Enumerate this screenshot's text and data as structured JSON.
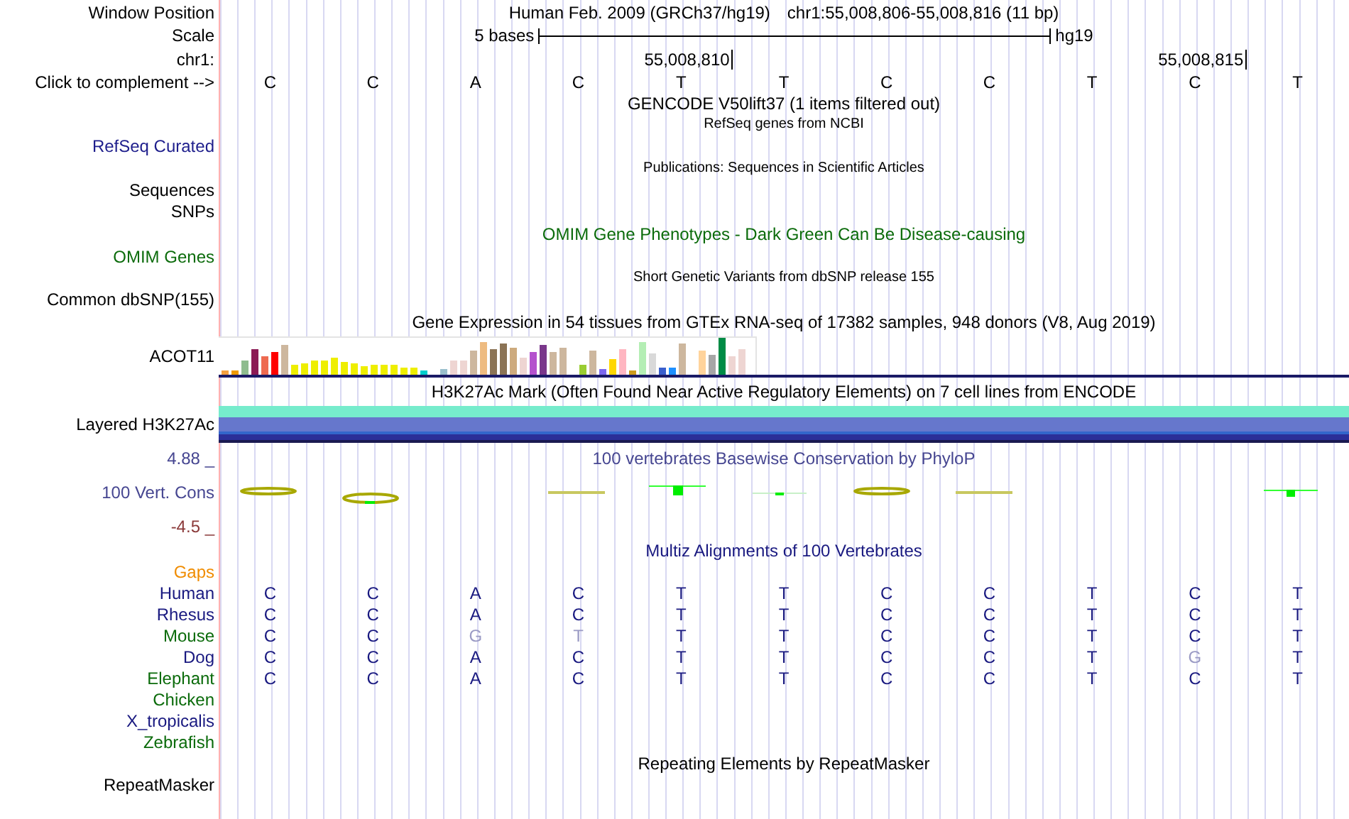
{
  "header": {
    "window_position_label": "Window Position",
    "assembly": "Human Feb. 2009 (GRCh37/hg19)",
    "position": "chr1:55,008,806-55,008,816 (11 bp)",
    "scale_label": "Scale",
    "scale_text": "5 bases",
    "scale_db": "hg19",
    "chrom_label": "chr1:",
    "complement_label": "Click to complement -->"
  },
  "sequence": [
    {
      "base": "C"
    },
    {
      "base": "C"
    },
    {
      "base": "A"
    },
    {
      "base": "C"
    },
    {
      "base": "T",
      "tick": "55,008,810"
    },
    {
      "base": "T"
    },
    {
      "base": "C"
    },
    {
      "base": "C"
    },
    {
      "base": "T"
    },
    {
      "base": "C",
      "tick": "55,008,815"
    },
    {
      "base": "T"
    }
  ],
  "gencode": {
    "title": "GENCODE V50lift37 (1 items filtered out)"
  },
  "refseq": {
    "title": "RefSeq genes from NCBI",
    "label": "RefSeq Curated"
  },
  "publications": {
    "title": "Publications: Sequences in Scientific Articles",
    "labels": [
      "Sequences",
      "SNPs"
    ]
  },
  "omim": {
    "title": "OMIM Gene Phenotypes - Dark Green Can Be Disease-causing",
    "label": "OMIM Genes"
  },
  "dbsnp": {
    "title": "Short Genetic Variants from dbSNP release 155",
    "label": "Common dbSNP(155)"
  },
  "gtex": {
    "title": "Gene Expression in 54 tissues from GTEx RNA-seq of 17382 samples, 948 donors (V8, Aug 2019)",
    "label": "ACOT11"
  },
  "h3k27ac": {
    "title": "H3K27Ac Mark (Often Found Near Active Regulatory Elements) on 7 cell lines from ENCODE",
    "label": "Layered H3K27Ac"
  },
  "conservation": {
    "title": "100 vertebrates Basewise Conservation by PhyloP",
    "label": "100 Vert. Cons",
    "max": "4.88 _",
    "min": "-4.5 _"
  },
  "multiz": {
    "title": "Multiz Alignments of 100 Vertebrates",
    "species": [
      {
        "name": "Gaps",
        "color": "#f08c00"
      },
      {
        "name": "Human",
        "color": "#191980",
        "bases": [
          {
            "base": "C",
            "differs": false
          },
          {
            "base": "C",
            "differs": false
          },
          {
            "base": "A",
            "differs": false
          },
          {
            "base": "C",
            "differs": false
          },
          {
            "base": "T",
            "differs": false
          },
          {
            "base": "T",
            "differs": false
          },
          {
            "base": "C",
            "differs": false
          },
          {
            "base": "C",
            "differs": false
          },
          {
            "base": "T",
            "differs": false
          },
          {
            "base": "C",
            "differs": false
          },
          {
            "base": "T",
            "differs": false
          }
        ]
      },
      {
        "name": "Rhesus",
        "color": "#191980",
        "bases": [
          {
            "base": "C",
            "differs": false
          },
          {
            "base": "C",
            "differs": false
          },
          {
            "base": "A",
            "differs": false
          },
          {
            "base": "C",
            "differs": false
          },
          {
            "base": "T",
            "differs": false
          },
          {
            "base": "T",
            "differs": false
          },
          {
            "base": "C",
            "differs": false
          },
          {
            "base": "C",
            "differs": false
          },
          {
            "base": "T",
            "differs": false
          },
          {
            "base": "C",
            "differs": false
          },
          {
            "base": "T",
            "differs": false
          }
        ]
      },
      {
        "name": "Mouse",
        "color": "#0b6b0b",
        "bases": [
          {
            "base": "C",
            "differs": false
          },
          {
            "base": "C",
            "differs": false
          },
          {
            "base": "G",
            "differs": true
          },
          {
            "base": "T",
            "differs": true
          },
          {
            "base": "T",
            "differs": false
          },
          {
            "base": "T",
            "differs": false
          },
          {
            "base": "C",
            "differs": false
          },
          {
            "base": "C",
            "differs": false
          },
          {
            "base": "T",
            "differs": false
          },
          {
            "base": "C",
            "differs": false
          },
          {
            "base": "T",
            "differs": false
          }
        ]
      },
      {
        "name": "Dog",
        "color": "#191980",
        "bases": [
          {
            "base": "C",
            "differs": false
          },
          {
            "base": "C",
            "differs": false
          },
          {
            "base": "A",
            "differs": false
          },
          {
            "base": "C",
            "differs": false
          },
          {
            "base": "T",
            "differs": false
          },
          {
            "base": "T",
            "differs": false
          },
          {
            "base": "C",
            "differs": false
          },
          {
            "base": "C",
            "differs": false
          },
          {
            "base": "T",
            "differs": false
          },
          {
            "base": "G",
            "differs": true
          },
          {
            "base": "T",
            "differs": false
          }
        ]
      },
      {
        "name": "Elephant",
        "color": "#0b6b0b",
        "bases": [
          {
            "base": "C",
            "differs": false
          },
          {
            "base": "C",
            "differs": false
          },
          {
            "base": "A",
            "differs": false
          },
          {
            "base": "C",
            "differs": false
          },
          {
            "base": "T",
            "differs": false
          },
          {
            "base": "T",
            "differs": false
          },
          {
            "base": "C",
            "differs": false
          },
          {
            "base": "C",
            "differs": false
          },
          {
            "base": "T",
            "differs": false
          },
          {
            "base": "C",
            "differs": false
          },
          {
            "base": "T",
            "differs": false
          }
        ]
      },
      {
        "name": "Chicken",
        "color": "#0b6b0b"
      },
      {
        "name": "X_tropicalis",
        "color": "#191980"
      },
      {
        "name": "Zebrafish",
        "color": "#0b6b0b"
      }
    ]
  },
  "repeatmasker": {
    "title": "Repeating Elements by RepeatMasker",
    "label": "RepeatMasker"
  }
}
